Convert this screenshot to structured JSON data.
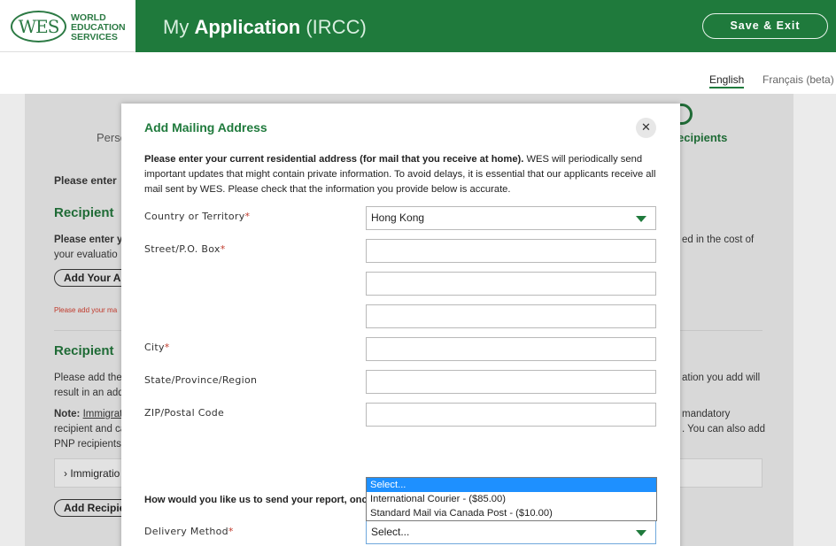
{
  "header": {
    "logo_mark": "WES",
    "logo_line1": "WORLD",
    "logo_line2": "EDUCATION",
    "logo_line3": "SERVICES",
    "title_prefix": "My",
    "title_bold": "Application",
    "title_suffix": "(IRCC)",
    "save_exit_label": "Save & Exit"
  },
  "language": {
    "english": "English",
    "french": "Français (beta)"
  },
  "background": {
    "step_personal": "Perso",
    "step_recipients": "ecipients",
    "please_enter": "Please enter",
    "recipient_heading_1": "Recipient",
    "please_enter_your": "Please enter yo",
    "your_evaluation": "your evaluatio",
    "included_cost": "ed in the cost of",
    "add_your_button": "Add Your Ac",
    "please_add_error": "Please add your ma",
    "recipient_heading_2": "Recipient",
    "please_add_the": "Please add the",
    "result_in_an": "result in an add",
    "location_you_add": "ation you add will",
    "note_label": "Note:",
    "note_immigra": "Immigrat",
    "mandatory": "mandatory",
    "recipient_and": "recipient and ca",
    "you_can_also": ". You can also add",
    "pnp_recipients": "PNP recipients",
    "accordion_label": "Immigratio",
    "add_recipient_button": "Add Recipie"
  },
  "modal": {
    "title": "Add Mailing Address",
    "close_glyph": "✕",
    "intro_bold": "Please enter your current residential address (for mail that you receive at home).",
    "intro_rest": " WES will periodically send important updates that might contain private information. To avoid delays, it is essential that our applicants receive all mail sent by WES. Please check that the information you provide below is accurate.",
    "country_label": "Country or Territory",
    "country_value": "Hong Kong",
    "street_label": "Street/P.O. Box",
    "city_label": "City",
    "state_label": "State/Province/Region",
    "zip_label": "ZIP/Postal Code",
    "question": "How would you like us to send your report, once",
    "delivery_label": "Delivery Method",
    "delivery_value": "Select...",
    "required_mark": "*"
  },
  "dropdown": {
    "options": [
      "Select...",
      "International Courier - ($85.00)",
      "Standard Mail via Canada Post - ($10.00)"
    ],
    "selected_index": 0
  },
  "colors": {
    "brand_green": "#1f7a3c",
    "highlight_blue": "#1e90ff",
    "required_red": "#c0392b"
  }
}
